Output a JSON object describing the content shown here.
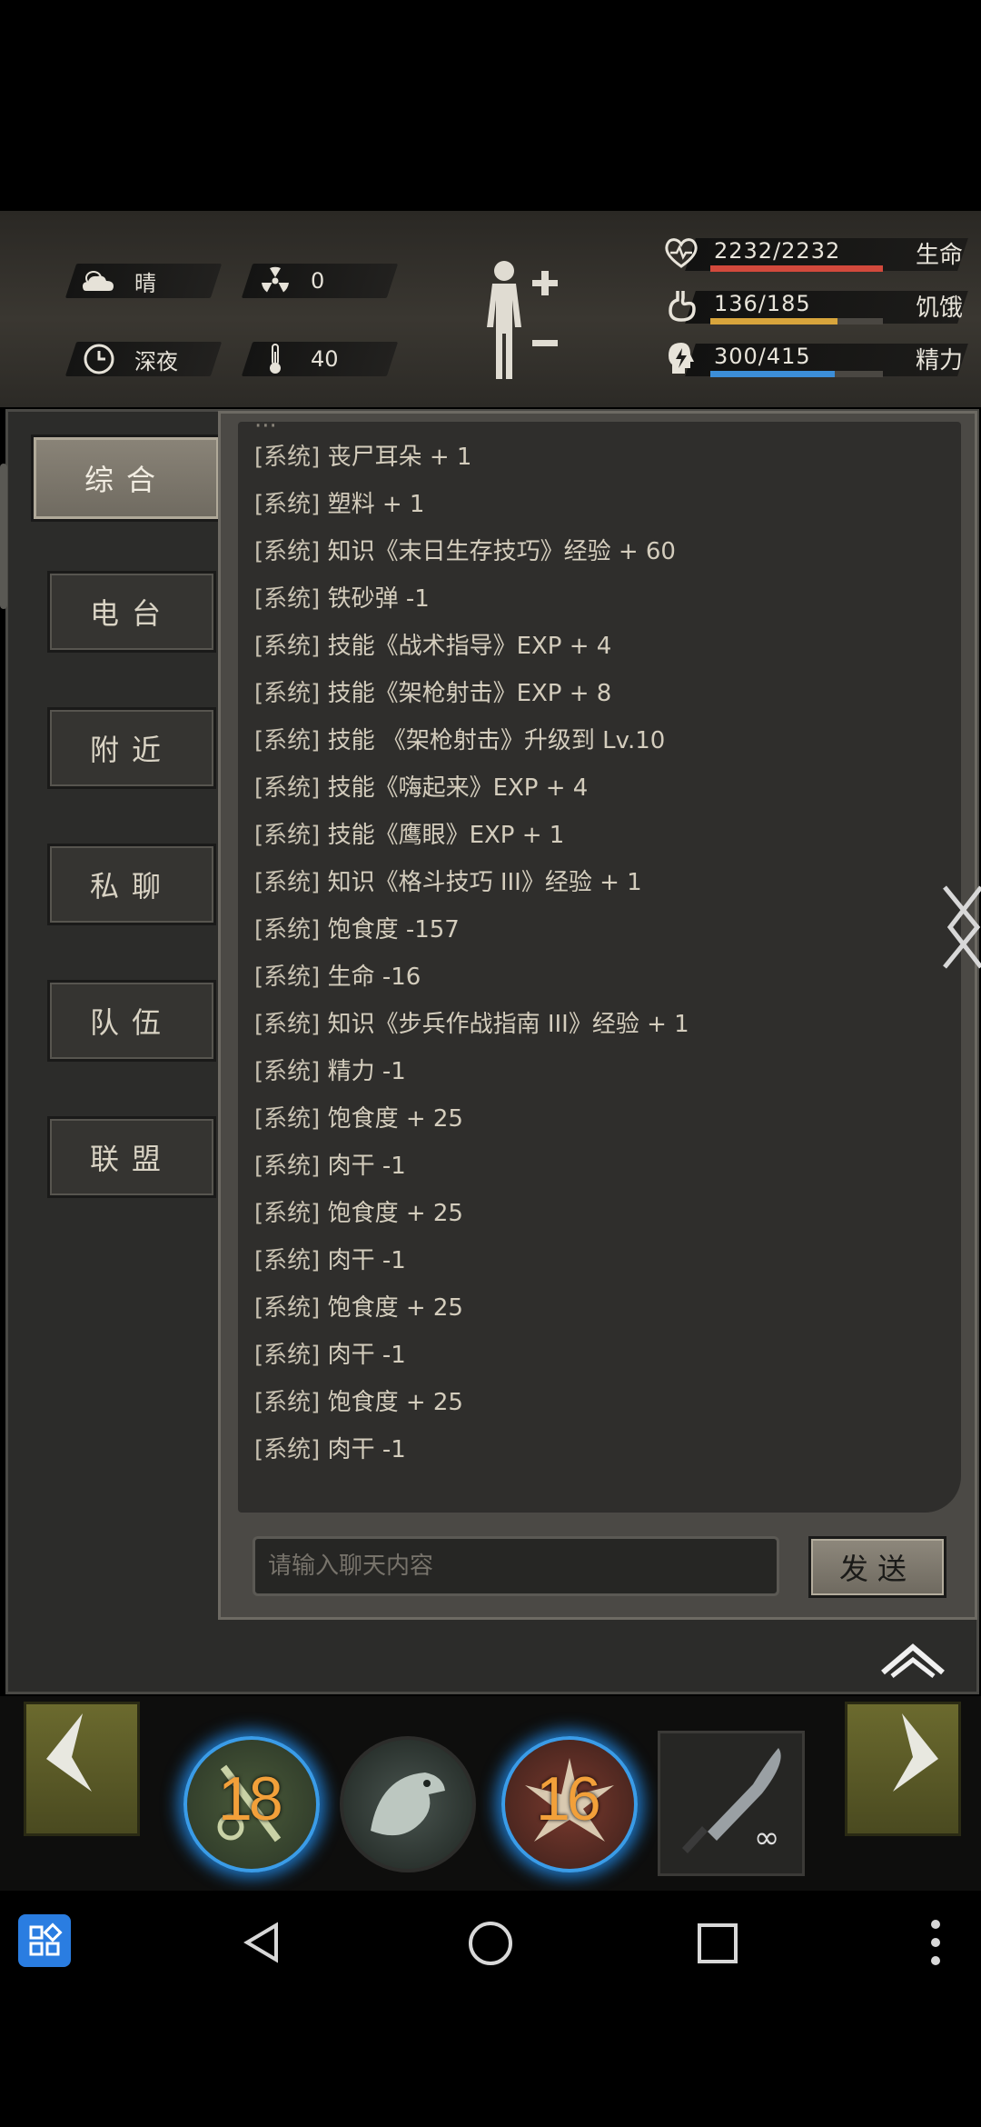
{
  "hud": {
    "weather": "晴",
    "radiation": "0",
    "time_of_day": "深夜",
    "temperature": "40",
    "stats": [
      {
        "value": "2232/2232",
        "name": "生命",
        "fill": 1.0,
        "color": "#d2493c"
      },
      {
        "value": "136/185",
        "name": "饥饿",
        "fill": 0.735,
        "color": "#d8a53c"
      },
      {
        "value": "300/415",
        "name": "精力",
        "fill": 0.723,
        "color": "#3c8ed8"
      }
    ]
  },
  "tabs": [
    "综合",
    "电台",
    "附近",
    "私聊",
    "队伍",
    "联盟"
  ],
  "active_tab": "综合",
  "chat": {
    "messages": [
      {
        "tag": "[系统]",
        "text": "丧尸耳朵 + 1"
      },
      {
        "tag": "[系统]",
        "text": "塑料 + 1"
      },
      {
        "tag": "[系统]",
        "text": "知识《末日生存技巧》经验 + 60"
      },
      {
        "tag": "[系统]",
        "text": "铁砂弹 -1"
      },
      {
        "tag": "[系统]",
        "text": "技能《战术指导》EXP + 4"
      },
      {
        "tag": "[系统]",
        "text": "技能《架枪射击》EXP + 8"
      },
      {
        "tag": "[系统]",
        "text": "技能 《架枪射击》升级到 Lv.10"
      },
      {
        "tag": "[系统]",
        "text": "技能《嗨起来》EXP + 4"
      },
      {
        "tag": "[系统]",
        "text": "技能《鹰眼》EXP + 1"
      },
      {
        "tag": "[系统]",
        "text": "知识《格斗技巧 III》经验 + 1"
      },
      {
        "tag": "[系统]",
        "text": "饱食度 -157"
      },
      {
        "tag": "[系统]",
        "text": "生命 -16"
      },
      {
        "tag": "[系统]",
        "text": "知识《步兵作战指南 III》经验 + 1"
      },
      {
        "tag": "[系统]",
        "text": "精力 -1"
      },
      {
        "tag": "[系统]",
        "text": "饱食度 + 25"
      },
      {
        "tag": "[系统]",
        "text": "肉干 -1"
      },
      {
        "tag": "[系统]",
        "text": "饱食度 + 25"
      },
      {
        "tag": "[系统]",
        "text": "肉干 -1"
      },
      {
        "tag": "[系统]",
        "text": "饱食度 + 25"
      },
      {
        "tag": "[系统]",
        "text": "肉干 -1"
      },
      {
        "tag": "[系统]",
        "text": "饱食度 + 25"
      },
      {
        "tag": "[系统]",
        "text": "肉干 -1"
      }
    ],
    "input_placeholder": "请输入聊天内容",
    "send_label": "发送"
  },
  "skills": [
    {
      "icon": "scroll-skill-icon",
      "count": "18"
    },
    {
      "icon": "eagle-skill-icon",
      "count": ""
    },
    {
      "icon": "burst-skill-icon",
      "count": "16"
    }
  ],
  "weapon": {
    "icon": "knife-icon",
    "ammo": "∞"
  }
}
